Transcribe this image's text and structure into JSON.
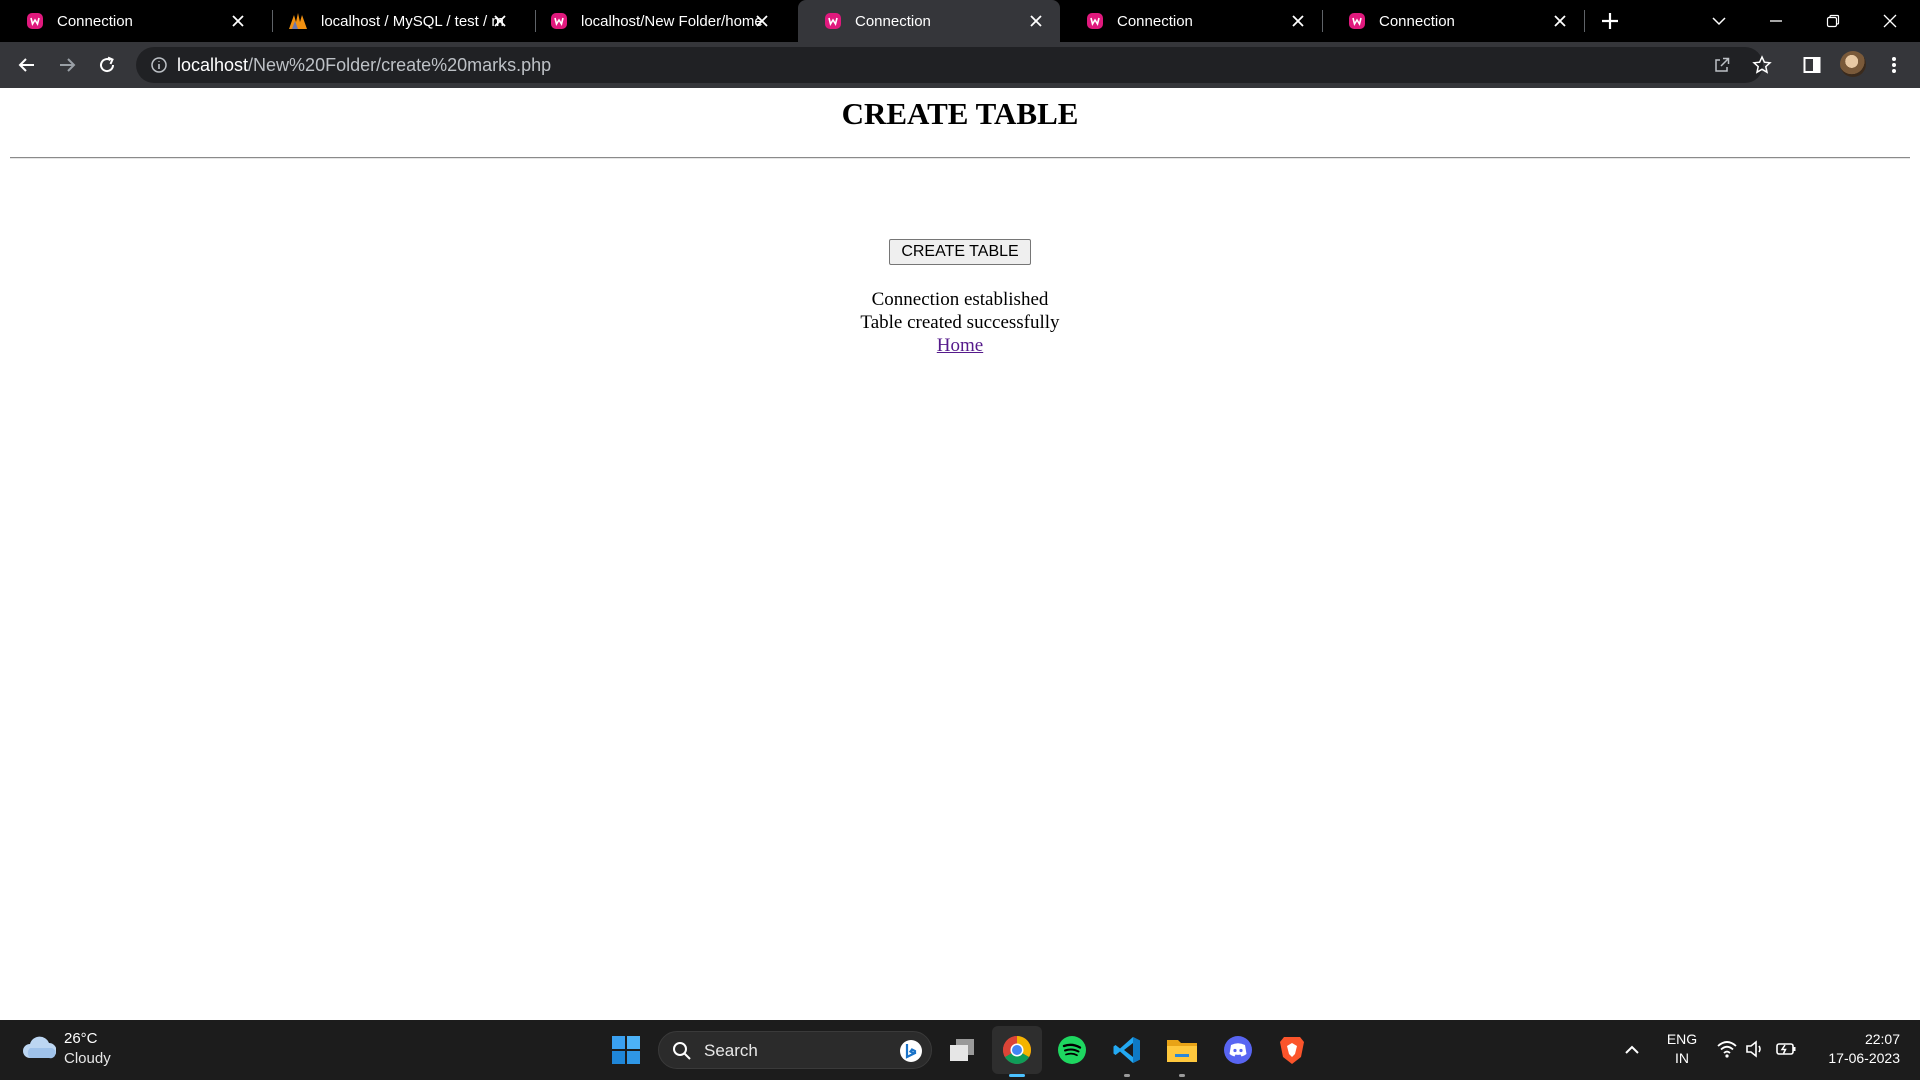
{
  "browser": {
    "tabs": [
      {
        "title": "Connection",
        "favicon": "wamp-icon",
        "active": false
      },
      {
        "title": "localhost / MySQL / test / marks | phpMyAdmin",
        "favicon": "phpmyadmin-icon",
        "active": false
      },
      {
        "title": "localhost/New Folder/home",
        "favicon": "wamp-icon",
        "active": false
      },
      {
        "title": "Connection",
        "favicon": "wamp-icon",
        "active": true
      },
      {
        "title": "Connection",
        "favicon": "wamp-icon",
        "active": false
      },
      {
        "title": "Connection",
        "favicon": "wamp-icon",
        "active": false
      }
    ],
    "url_host": "localhost",
    "url_path": "/New%20Folder/create%20marks.php"
  },
  "page": {
    "heading": "CREATE TABLE",
    "button_label": "CREATE TABLE",
    "message_connection": "Connection established",
    "message_table": "Table created successfully",
    "home_link": "Home"
  },
  "taskbar": {
    "weather_temp": "26°C",
    "weather_condition": "Cloudy",
    "search_label": "Search",
    "apps": [
      "start",
      "search",
      "task-view",
      "chrome",
      "spotify",
      "vscode",
      "file-explorer",
      "discord",
      "brave"
    ],
    "lang_primary": "ENG",
    "lang_secondary": "IN",
    "time": "22:07",
    "date": "17-06-2023"
  },
  "colors": {
    "favicon_wamp": "#e0197d",
    "link_visited": "#551a8b",
    "tab_active_bg": "#35363a",
    "taskbar_bg": "#1c1c1c"
  }
}
